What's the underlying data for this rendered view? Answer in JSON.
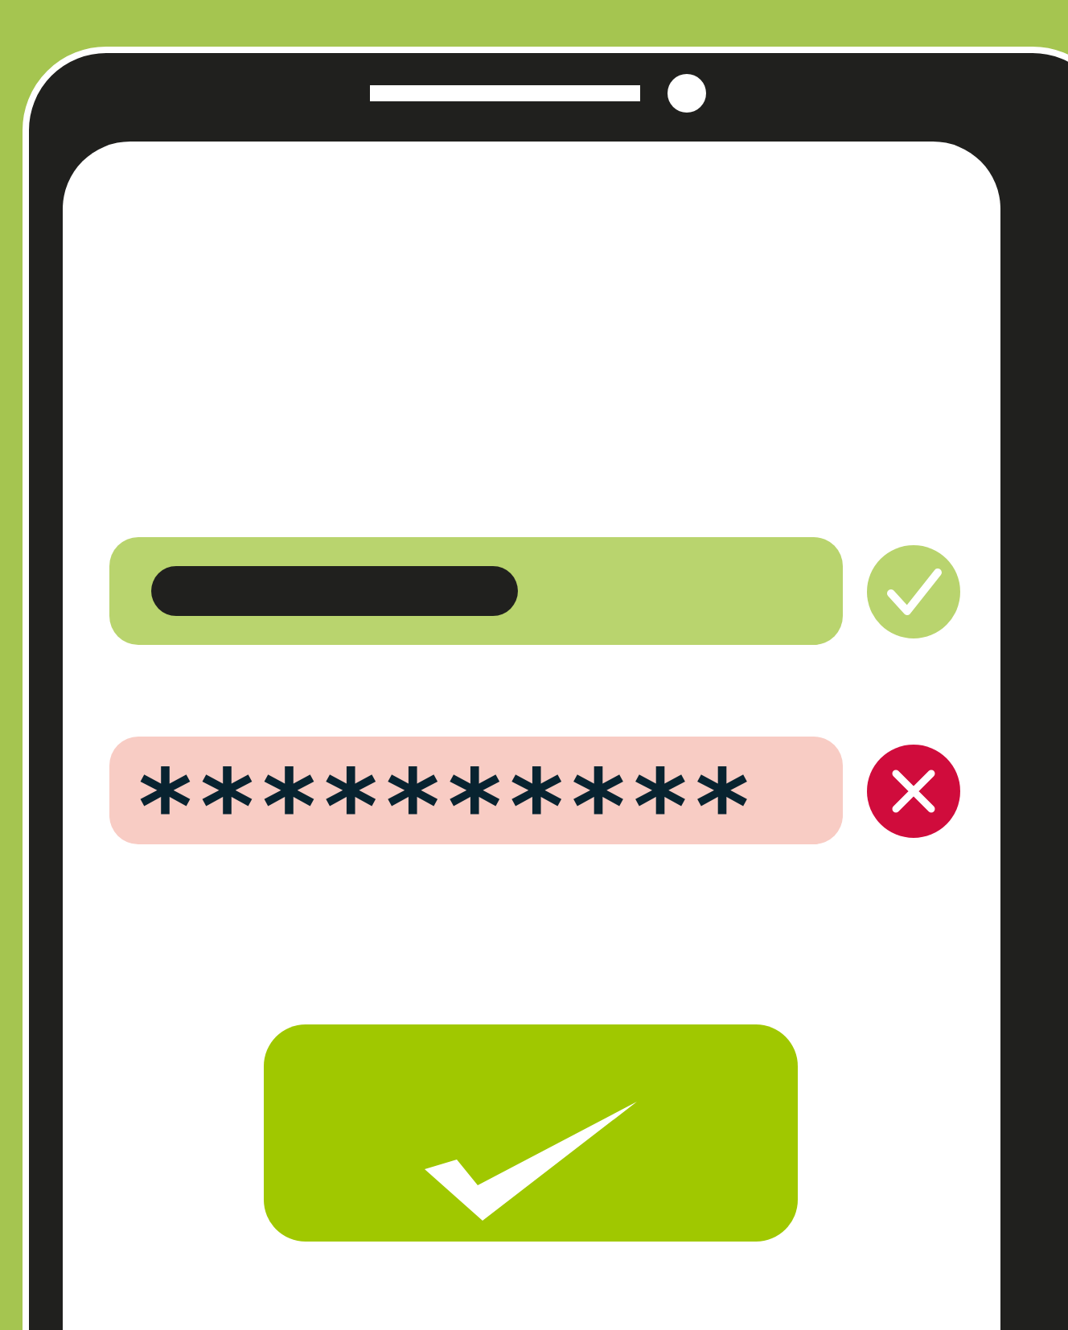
{
  "fields": [
    {
      "kind": "username",
      "valid": true
    },
    {
      "kind": "password",
      "value": "**********",
      "valid": false
    }
  ]
}
